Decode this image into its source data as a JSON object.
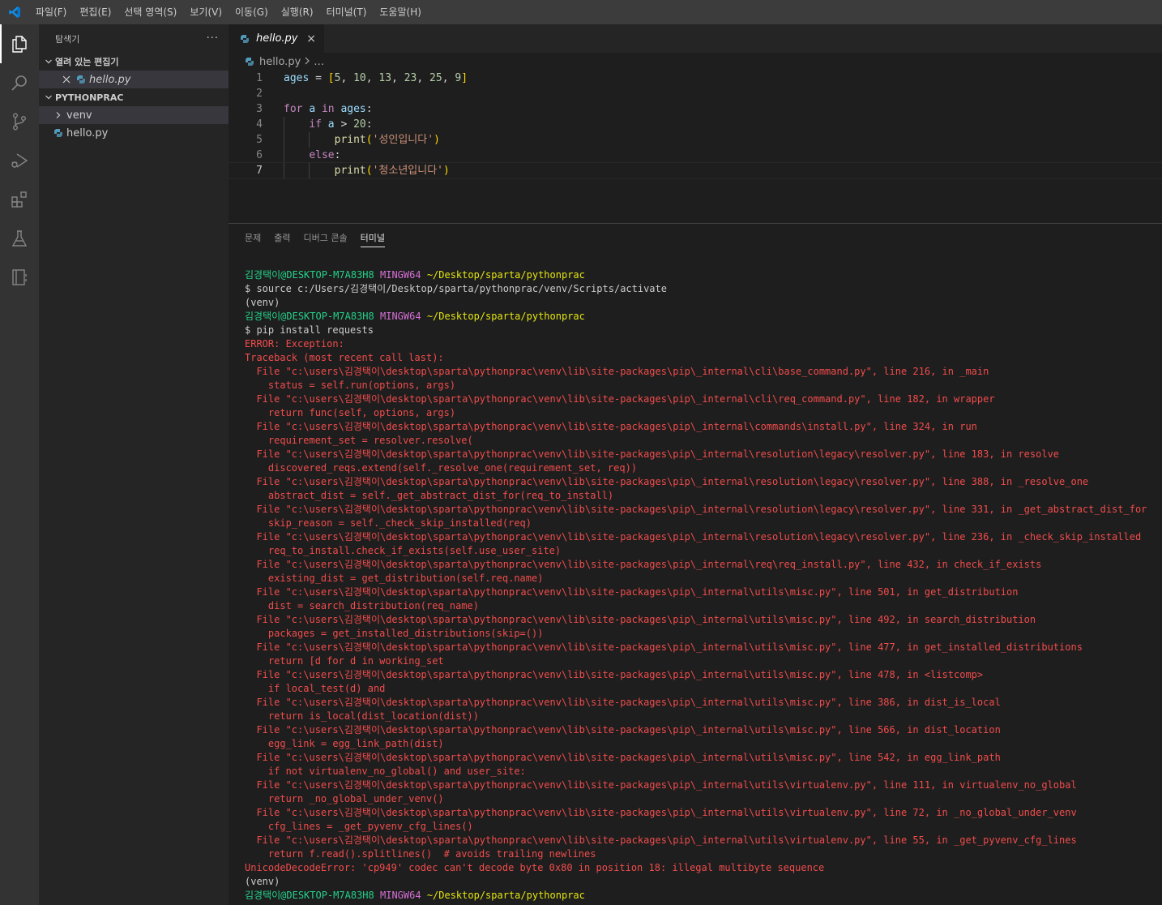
{
  "menubar": {
    "items": [
      "파일(F)",
      "편집(E)",
      "선택 영역(S)",
      "보기(V)",
      "이동(G)",
      "실행(R)",
      "터미널(T)",
      "도움말(H)"
    ]
  },
  "activitybar": {
    "icons": [
      "files-icon",
      "search-icon",
      "source-control-icon",
      "run-debug-icon",
      "extensions-icon",
      "testing-icon",
      "remote-explorer-icon"
    ]
  },
  "sidebar": {
    "title": "탐색기",
    "more": "···",
    "open_editors_label": "열려 있는 편집기",
    "open_editors": [
      {
        "label": "hello.py"
      }
    ],
    "project_label": "PYTHONPRAC",
    "tree": [
      {
        "label": "venv",
        "type": "folder"
      },
      {
        "label": "hello.py",
        "type": "file"
      }
    ]
  },
  "editor": {
    "tab_label": "hello.py",
    "tab_close": "×",
    "breadcrumb_file": "hello.py",
    "breadcrumb_rest": "…",
    "line_numbers": [
      "1",
      "2",
      "3",
      "4",
      "5",
      "6",
      "7"
    ]
  },
  "panel": {
    "tabs": [
      "문제",
      "출력",
      "디버그 콘솔",
      "터미널"
    ],
    "active_tab": "터미널"
  },
  "terminal": {
    "prompt_user": "김경택이@DESKTOP-M7A83H8",
    "prompt_env": "MINGW64",
    "prompt_path": "~/Desktop/sparta/pythonprac",
    "cmd1": "$ source c:/Users/김경택이/Desktop/sparta/pythonprac/venv/Scripts/activate",
    "venv": "(venv)",
    "cmd2": "$ pip install requests",
    "error_lines": [
      "ERROR: Exception:",
      "Traceback (most recent call last):",
      "  File \"c:\\users\\김경택이\\desktop\\sparta\\pythonprac\\venv\\lib\\site-packages\\pip\\_internal\\cli\\base_command.py\", line 216, in _main",
      "    status = self.run(options, args)",
      "  File \"c:\\users\\김경택이\\desktop\\sparta\\pythonprac\\venv\\lib\\site-packages\\pip\\_internal\\cli\\req_command.py\", line 182, in wrapper",
      "    return func(self, options, args)",
      "  File \"c:\\users\\김경택이\\desktop\\sparta\\pythonprac\\venv\\lib\\site-packages\\pip\\_internal\\commands\\install.py\", line 324, in run",
      "    requirement_set = resolver.resolve(",
      "  File \"c:\\users\\김경택이\\desktop\\sparta\\pythonprac\\venv\\lib\\site-packages\\pip\\_internal\\resolution\\legacy\\resolver.py\", line 183, in resolve",
      "    discovered_reqs.extend(self._resolve_one(requirement_set, req))",
      "  File \"c:\\users\\김경택이\\desktop\\sparta\\pythonprac\\venv\\lib\\site-packages\\pip\\_internal\\resolution\\legacy\\resolver.py\", line 388, in _resolve_one",
      "    abstract_dist = self._get_abstract_dist_for(req_to_install)",
      "  File \"c:\\users\\김경택이\\desktop\\sparta\\pythonprac\\venv\\lib\\site-packages\\pip\\_internal\\resolution\\legacy\\resolver.py\", line 331, in _get_abstract_dist_for",
      "    skip_reason = self._check_skip_installed(req)",
      "  File \"c:\\users\\김경택이\\desktop\\sparta\\pythonprac\\venv\\lib\\site-packages\\pip\\_internal\\resolution\\legacy\\resolver.py\", line 236, in _check_skip_installed",
      "    req_to_install.check_if_exists(self.use_user_site)",
      "  File \"c:\\users\\김경택이\\desktop\\sparta\\pythonprac\\venv\\lib\\site-packages\\pip\\_internal\\req\\req_install.py\", line 432, in check_if_exists",
      "    existing_dist = get_distribution(self.req.name)",
      "  File \"c:\\users\\김경택이\\desktop\\sparta\\pythonprac\\venv\\lib\\site-packages\\pip\\_internal\\utils\\misc.py\", line 501, in get_distribution",
      "    dist = search_distribution(req_name)",
      "  File \"c:\\users\\김경택이\\desktop\\sparta\\pythonprac\\venv\\lib\\site-packages\\pip\\_internal\\utils\\misc.py\", line 492, in search_distribution",
      "    packages = get_installed_distributions(skip=())",
      "  File \"c:\\users\\김경택이\\desktop\\sparta\\pythonprac\\venv\\lib\\site-packages\\pip\\_internal\\utils\\misc.py\", line 477, in get_installed_distributions",
      "    return [d for d in working_set",
      "  File \"c:\\users\\김경택이\\desktop\\sparta\\pythonprac\\venv\\lib\\site-packages\\pip\\_internal\\utils\\misc.py\", line 478, in <listcomp>",
      "    if local_test(d) and",
      "  File \"c:\\users\\김경택이\\desktop\\sparta\\pythonprac\\venv\\lib\\site-packages\\pip\\_internal\\utils\\misc.py\", line 386, in dist_is_local",
      "    return is_local(dist_location(dist))",
      "  File \"c:\\users\\김경택이\\desktop\\sparta\\pythonprac\\venv\\lib\\site-packages\\pip\\_internal\\utils\\misc.py\", line 566, in dist_location",
      "    egg_link = egg_link_path(dist)",
      "  File \"c:\\users\\김경택이\\desktop\\sparta\\pythonprac\\venv\\lib\\site-packages\\pip\\_internal\\utils\\misc.py\", line 542, in egg_link_path",
      "    if not virtualenv_no_global() and user_site:",
      "  File \"c:\\users\\김경택이\\desktop\\sparta\\pythonprac\\venv\\lib\\site-packages\\pip\\_internal\\utils\\virtualenv.py\", line 111, in virtualenv_no_global",
      "    return _no_global_under_venv()",
      "  File \"c:\\users\\김경택이\\desktop\\sparta\\pythonprac\\venv\\lib\\site-packages\\pip\\_internal\\utils\\virtualenv.py\", line 72, in _no_global_under_venv",
      "    cfg_lines = _get_pyvenv_cfg_lines()",
      "  File \"c:\\users\\김경택이\\desktop\\sparta\\pythonprac\\venv\\lib\\site-packages\\pip\\_internal\\utils\\virtualenv.py\", line 55, in _get_pyvenv_cfg_lines",
      "    return f.read().splitlines()  # avoids trailing newlines",
      "UnicodeDecodeError: 'cp949' codec can't decode byte 0x80 in position 18: illegal multibyte sequence"
    ]
  },
  "colors": {
    "accent": "#007acc",
    "terminal_red": "#f14c4c",
    "terminal_green": "#23d18b",
    "terminal_yellow": "#e5e510",
    "terminal_magenta": "#d670d6"
  }
}
